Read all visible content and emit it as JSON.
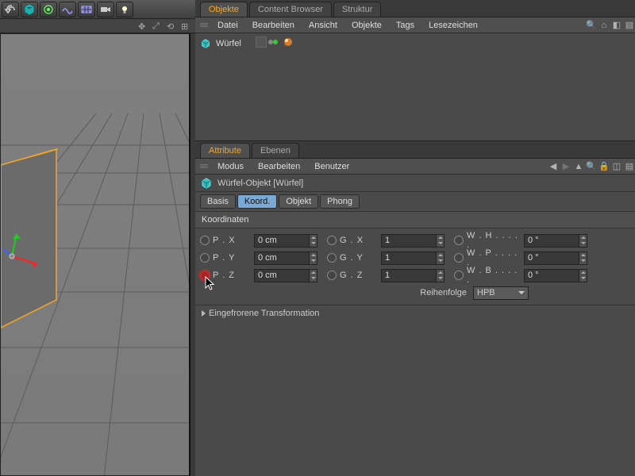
{
  "object_tabs": {
    "t0": "Objekte",
    "t1": "Content Browser",
    "t2": "Struktur"
  },
  "obj_menu": {
    "m0": "Datei",
    "m1": "Bearbeiten",
    "m2": "Ansicht",
    "m3": "Objekte",
    "m4": "Tags",
    "m5": "Lesezeichen"
  },
  "object_tree": {
    "item0_name": "Würfel"
  },
  "attr_tabs": {
    "t0": "Attribute",
    "t1": "Ebenen"
  },
  "attr_menu": {
    "m0": "Modus",
    "m1": "Bearbeiten",
    "m2": "Benutzer"
  },
  "obj_title": "Würfel-Objekt [Würfel]",
  "subtabs": {
    "s0": "Basis",
    "s1": "Koord.",
    "s2": "Objekt",
    "s3": "Phong"
  },
  "section": "Koordinaten",
  "coords": {
    "px_label": "P . X",
    "px_value": "0 cm",
    "py_label": "P . Y",
    "py_value": "0 cm",
    "pz_label": "P . Z",
    "pz_value": "0 cm",
    "gx_label": "G . X",
    "gx_value": "1",
    "gy_label": "G . Y",
    "gy_value": "1",
    "gz_label": "G . Z",
    "gz_value": "1",
    "wh_label": "W . H . . . . .",
    "wh_value": "0 °",
    "wp_label": "W . P . . . . .",
    "wp_value": "0 °",
    "wb_label": "W . B . . . . .",
    "wb_value": "0 °"
  },
  "order": {
    "label": "Reihenfolge",
    "value": "HPB"
  },
  "frozen": "Eingefrorene Transformation"
}
